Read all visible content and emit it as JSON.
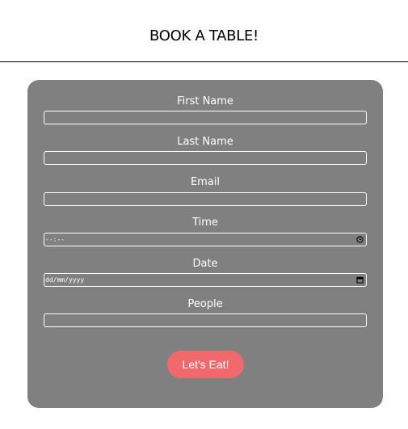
{
  "page": {
    "title": "BOOK A TABLE!"
  },
  "form": {
    "fields": [
      {
        "label": "First Name",
        "placeholder": ""
      },
      {
        "label": "Last Name",
        "placeholder": ""
      },
      {
        "label": "Email",
        "placeholder": ""
      },
      {
        "label": "Time",
        "placeholder": "--:--",
        "icon": "clock-icon"
      },
      {
        "label": "Date",
        "placeholder": "dd/mm/yyyy",
        "icon": "calendar-icon"
      },
      {
        "label": "People",
        "placeholder": ""
      }
    ],
    "submit_label": "Let's Eat!"
  },
  "colors": {
    "card_background": "#808080",
    "button_background": "#f0696c",
    "text": "#ffffff"
  }
}
